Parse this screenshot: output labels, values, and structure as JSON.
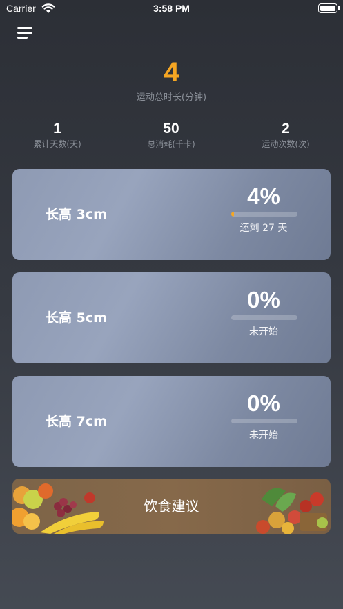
{
  "status_bar": {
    "carrier": "Carrier",
    "time": "3:58 PM",
    "wifi_icon": "wifi-icon",
    "battery_icon": "battery-icon"
  },
  "header": {
    "menu_icon": "hamburger-menu-icon"
  },
  "total": {
    "value": "4",
    "label": "运动总时长(分钟)"
  },
  "stats": [
    {
      "value": "1",
      "label": "累计天数(天)"
    },
    {
      "value": "50",
      "label": "总消耗(千卡)"
    },
    {
      "value": "2",
      "label": "运动次数(次)"
    }
  ],
  "goals": [
    {
      "title": "长高 3cm",
      "percent_text": "4%",
      "progress": 0.04,
      "status": "还剩 27 天"
    },
    {
      "title": "长高 5cm",
      "percent_text": "0%",
      "progress": 0,
      "status": "未开始"
    },
    {
      "title": "长高 7cm",
      "percent_text": "0%",
      "progress": 0,
      "status": "未开始"
    }
  ],
  "diet": {
    "label": "饮食建议",
    "image_icon": "fruits-vegetables-image"
  },
  "colors": {
    "accent": "#f5a623",
    "card": "#8e9ab3",
    "muted_text": "#8a8f98",
    "banner": "#7d6448"
  }
}
